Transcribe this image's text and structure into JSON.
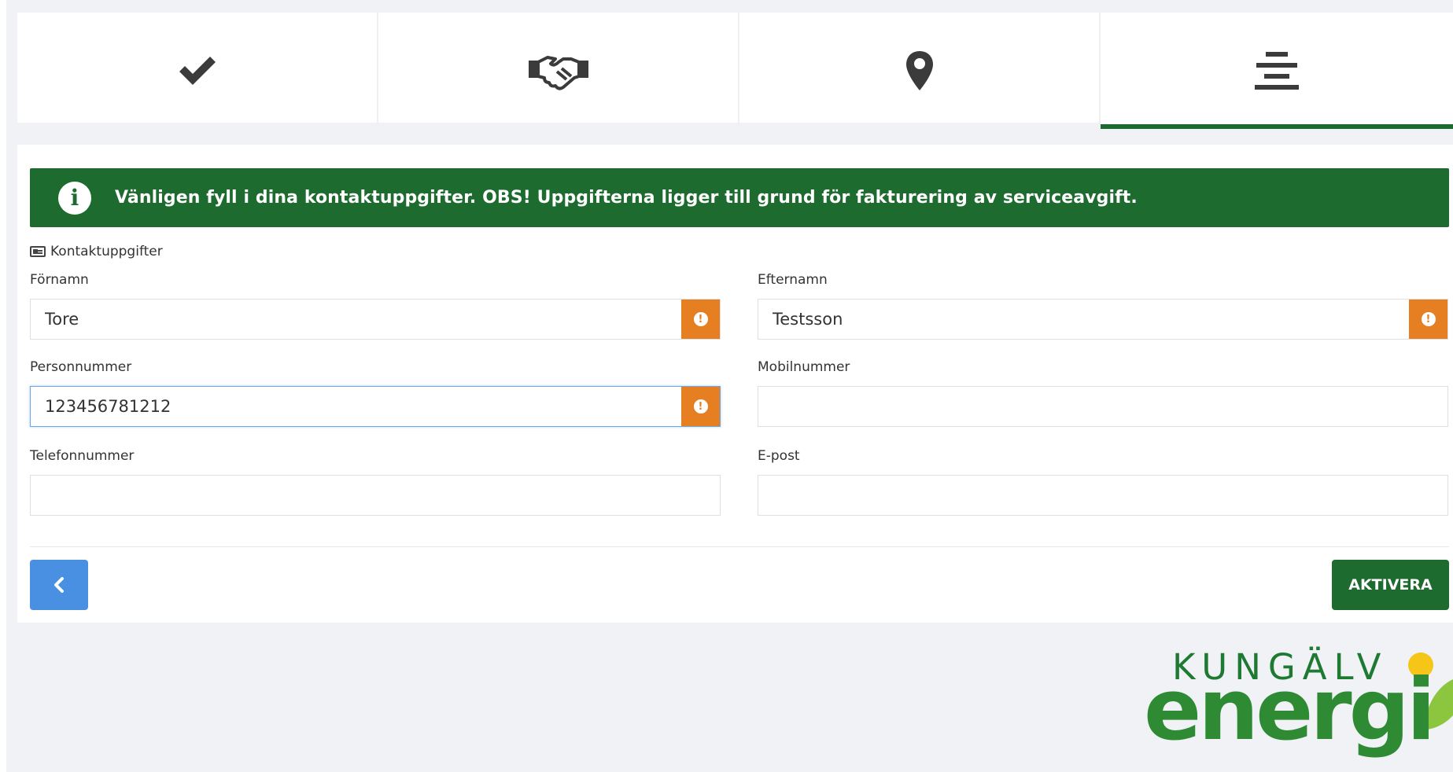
{
  "steps": [
    {
      "icon": "checkmark-icon",
      "state": "done"
    },
    {
      "icon": "handshake-icon",
      "state": "done"
    },
    {
      "icon": "map-marker-icon",
      "state": "done"
    },
    {
      "icon": "align-center-icon",
      "state": "active"
    }
  ],
  "colors": {
    "brand_green": "#1e6b2f",
    "warning_orange": "#e67e22",
    "back_blue": "#4a90e2",
    "focus_blue": "#6aa5e4"
  },
  "alert": {
    "icon": "info-circle-icon",
    "text": "Vänligen fyll i dina kontaktuppgifter. OBS! Uppgifterna ligger till grund för fakturering av serviceavgift."
  },
  "section": {
    "icon": "id-card-icon",
    "label": "Kontaktuppgifter"
  },
  "fields": {
    "first_name": {
      "label": "Förnamn",
      "value": "Tore",
      "warning": true
    },
    "last_name": {
      "label": "Efternamn",
      "value": "Testsson",
      "warning": true
    },
    "personal_number": {
      "label": "Personnummer",
      "value": "123456781212",
      "warning": true,
      "focused": true
    },
    "mobile": {
      "label": "Mobilnummer",
      "value": ""
    },
    "phone": {
      "label": "Telefonnummer",
      "value": ""
    },
    "email": {
      "label": "E-post",
      "value": ""
    }
  },
  "buttons": {
    "back_icon": "chevron-left-icon",
    "activate_label": "AKTIVERA"
  },
  "logo": {
    "top": "KUNGÄLV",
    "bottom": "energi"
  }
}
